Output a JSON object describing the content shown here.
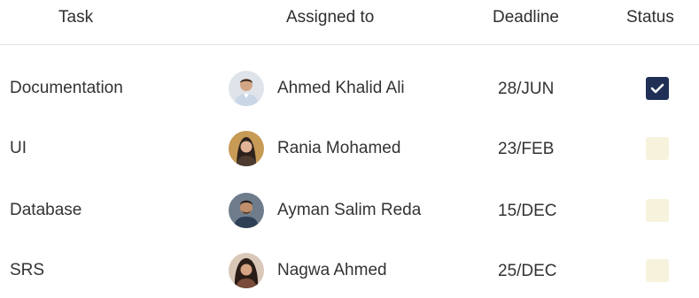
{
  "header": {
    "task": "Task",
    "assigned_to": "Assigned to",
    "deadline": "Deadline",
    "status": "Status"
  },
  "rows": [
    {
      "task": "Documentation",
      "assignee": "Ahmed Khalid Ali",
      "deadline": "28/JUN",
      "status_checked": true
    },
    {
      "task": "UI",
      "assignee": "Rania Mohamed",
      "deadline": "23/FEB",
      "status_checked": false
    },
    {
      "task": "Database",
      "assignee": "Ayman Salim Reda",
      "deadline": "15/DEC",
      "status_checked": false
    },
    {
      "task": "SRS",
      "assignee": "Nagwa Ahmed",
      "deadline": "25/DEC",
      "status_checked": false
    }
  ],
  "colors": {
    "checked_box": "#1f2f56",
    "unchecked_box": "#f7f2dc",
    "divider": "#e4e4e4"
  }
}
